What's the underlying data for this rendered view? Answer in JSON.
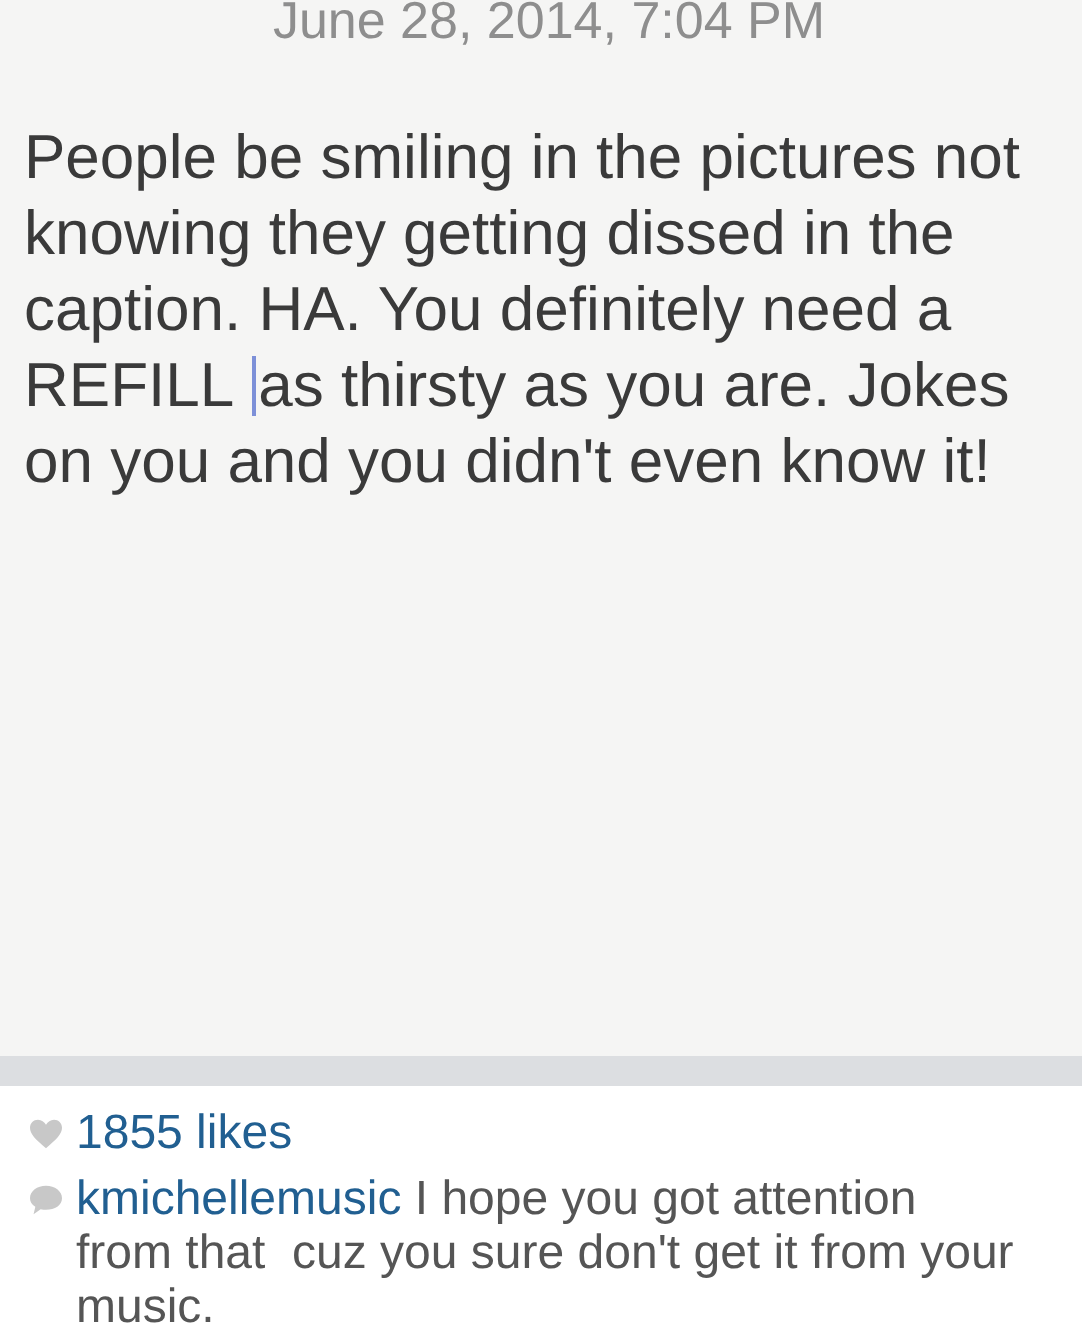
{
  "note": {
    "date": "June 28, 2014, 7:04 PM",
    "lines": [
      {
        "text": "People be smiling in the pictures not"
      },
      {
        "text": "knowing they getting dissed in the"
      },
      {
        "text": "caption. HA. You definitely need a"
      },
      {
        "text_before_cursor": "REFILL",
        "text_after_cursor": "as thirsty as you are. Jokes"
      },
      {
        "text": "on you and you didn't even know it!"
      }
    ]
  },
  "likes": "1855 likes",
  "comment": {
    "user": "kmichellemusic",
    "text": "I hope you got attention from that  cuz you sure don't get it from your music."
  }
}
